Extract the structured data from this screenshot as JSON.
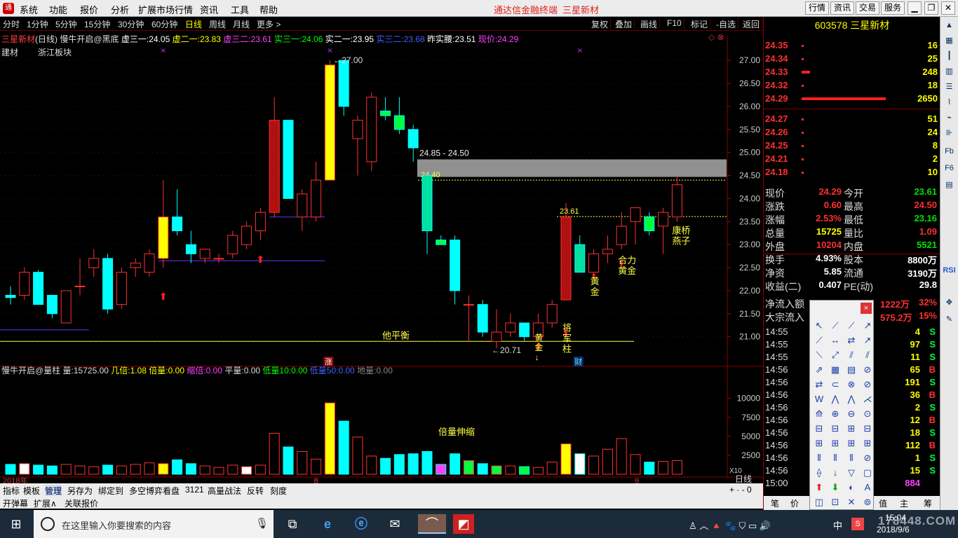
{
  "menu": {
    "items": [
      "系统",
      "功能",
      "报价",
      "分析",
      "扩展市场行情",
      "资讯",
      "工具",
      "帮助"
    ],
    "app_title": "通达信金融终端",
    "stock_title": "三星新材",
    "right_buttons": [
      "行情",
      "资讯",
      "交易",
      "服务"
    ]
  },
  "periods": {
    "items": [
      "分时",
      "1分钟",
      "5分钟",
      "15分钟",
      "30分钟",
      "60分钟",
      "日线",
      "周线",
      "月线",
      "更多 >"
    ],
    "active": "日线"
  },
  "toolbar": {
    "buttons": [
      "复权",
      "叠加",
      "画线",
      "F10",
      "标记",
      "-自选",
      "返回"
    ]
  },
  "info": {
    "stock": "三星新材",
    "period": "(日线)",
    "indicator": "慢牛开启@黑底",
    "items": [
      {
        "label": "虚三一:",
        "value": "24.05",
        "color": "#ffffff"
      },
      {
        "label": "虚二一:",
        "value": "23.83",
        "color": "#ffff00"
      },
      {
        "label": "虚三二:",
        "value": "23.61",
        "color": "#ff40ff"
      },
      {
        "label": "实三一:",
        "value": "24.06",
        "color": "#00ff00"
      },
      {
        "label": "实二一:",
        "value": "23.95",
        "color": "#ffffff"
      },
      {
        "label": "实三二:",
        "value": "23.68",
        "color": "#4060ff"
      },
      {
        "label": "昨实腰:",
        "value": "23.51",
        "color": "#ffffff"
      },
      {
        "label": "现价:",
        "value": "24.29",
        "color": "#ff40ff"
      }
    ],
    "sector1": "建材",
    "sector2": "浙江板块"
  },
  "chart_data": {
    "type": "candlestick",
    "y_range": [
      20.6,
      27.2
    ],
    "y_ticks": [
      "27.00",
      "26.50",
      "26.00",
      "25.50",
      "25.00",
      "24.50",
      "24.00",
      "23.50",
      "23.00",
      "22.50",
      "22.00",
      "21.50",
      "21.00"
    ],
    "candles": [
      {
        "o": 21.9,
        "h": 22.1,
        "l": 21.7,
        "c": 21.85
      },
      {
        "o": 21.9,
        "h": 22.5,
        "l": 21.8,
        "c": 22.4
      },
      {
        "o": 22.4,
        "h": 22.45,
        "l": 21.7,
        "c": 21.7
      },
      {
        "o": 21.9,
        "h": 21.9,
        "l": 21.4,
        "c": 21.5
      },
      {
        "o": 21.3,
        "h": 22.0,
        "l": 21.3,
        "c": 22.0
      },
      {
        "o": 22.1,
        "h": 22.7,
        "l": 21.9,
        "c": 22.1
      },
      {
        "o": 22.5,
        "h": 22.9,
        "l": 22.3,
        "c": 22.7
      },
      {
        "o": 22.7,
        "h": 22.8,
        "l": 21.5,
        "c": 21.6
      },
      {
        "o": 21.7,
        "h": 22.5,
        "l": 21.6,
        "c": 22.4
      },
      {
        "o": 22.5,
        "h": 22.7,
        "l": 22.3,
        "c": 22.6
      },
      {
        "o": 22.4,
        "h": 22.9,
        "l": 22.3,
        "c": 22.8
      },
      {
        "o": 22.7,
        "h": 24.4,
        "l": 22.5,
        "c": 23.6
      },
      {
        "o": 23.6,
        "h": 24.2,
        "l": 23.2,
        "c": 23.3
      },
      {
        "o": 23.0,
        "h": 23.3,
        "l": 22.6,
        "c": 22.8
      },
      {
        "o": 22.7,
        "h": 22.9,
        "l": 22.6,
        "c": 22.9
      },
      {
        "o": 22.7,
        "h": 22.8,
        "l": 22.6,
        "c": 22.7
      },
      {
        "o": 22.8,
        "h": 23.3,
        "l": 22.7,
        "c": 23.2
      },
      {
        "o": 23.0,
        "h": 23.5,
        "l": 22.9,
        "c": 23.4
      },
      {
        "o": 23.3,
        "h": 23.8,
        "l": 23.1,
        "c": 23.7
      },
      {
        "o": 23.7,
        "h": 26.2,
        "l": 23.6,
        "c": 25.7
      },
      {
        "o": 25.7,
        "h": 25.7,
        "l": 24.0,
        "c": 24.0
      },
      {
        "o": 23.6,
        "h": 24.2,
        "l": 23.3,
        "c": 24.1
      },
      {
        "o": 23.6,
        "h": 24.8,
        "l": 23.5,
        "c": 24.4
      },
      {
        "o": 24.4,
        "h": 27.0,
        "l": 24.4,
        "c": 26.9
      },
      {
        "o": 27.0,
        "h": 27.0,
        "l": 25.8,
        "c": 26.0
      },
      {
        "o": 25.3,
        "h": 25.8,
        "l": 24.5,
        "c": 25.7
      },
      {
        "o": 24.8,
        "h": 26.3,
        "l": 24.6,
        "c": 26.2
      },
      {
        "o": 25.9,
        "h": 26.2,
        "l": 25.7,
        "c": 25.8
      },
      {
        "o": 25.8,
        "h": 26.2,
        "l": 25.4,
        "c": 25.5
      },
      {
        "o": 25.5,
        "h": 25.6,
        "l": 24.8,
        "c": 25.1
      },
      {
        "o": 24.5,
        "h": 24.5,
        "l": 22.8,
        "c": 23.3
      },
      {
        "o": 23.1,
        "h": 23.2,
        "l": 23.0,
        "c": 23.0
      },
      {
        "o": 23.1,
        "h": 23.2,
        "l": 21.7,
        "c": 22.0
      },
      {
        "o": 21.7,
        "h": 21.9,
        "l": 20.9,
        "c": 21.7
      },
      {
        "o": 21.7,
        "h": 21.8,
        "l": 21.0,
        "c": 21.1
      },
      {
        "o": 20.9,
        "h": 21.6,
        "l": 20.75,
        "c": 21.1
      },
      {
        "o": 21.1,
        "h": 21.5,
        "l": 21.0,
        "c": 21.3
      },
      {
        "o": 21.3,
        "h": 21.3,
        "l": 20.9,
        "c": 21.0
      },
      {
        "o": 21.0,
        "h": 21.5,
        "l": 20.8,
        "c": 21.3
      },
      {
        "o": 21.3,
        "h": 21.8,
        "l": 21.2,
        "c": 21.7
      },
      {
        "o": 21.8,
        "h": 23.9,
        "l": 21.8,
        "c": 23.6
      },
      {
        "o": 23.0,
        "h": 23.2,
        "l": 22.4,
        "c": 22.4
      },
      {
        "o": 22.4,
        "h": 22.9,
        "l": 22.3,
        "c": 22.8
      },
      {
        "o": 22.8,
        "h": 23.2,
        "l": 22.6,
        "c": 22.9
      },
      {
        "o": 23.0,
        "h": 23.7,
        "l": 22.9,
        "c": 23.4
      },
      {
        "o": 23.5,
        "h": 23.8,
        "l": 23.0,
        "c": 23.8
      },
      {
        "o": 23.6,
        "h": 23.7,
        "l": 23.2,
        "c": 23.3
      },
      {
        "o": 23.4,
        "h": 23.8,
        "l": 22.8,
        "c": 23.7
      },
      {
        "o": 23.6,
        "h": 24.5,
        "l": 23.5,
        "c": 24.3
      }
    ],
    "volume_ticks": [
      "10000",
      "7500",
      "5000",
      "2500"
    ],
    "volume_max": 12000,
    "volumes": [
      1300,
      1400,
      1200,
      1100,
      1300,
      1100,
      1000,
      1200,
      1100,
      1300,
      1500,
      1400,
      1900,
      1400,
      1100,
      900,
      1200,
      1000,
      1200,
      5400,
      3600,
      3000,
      2000,
      9400,
      7000,
      4900,
      2400,
      2100,
      2600,
      2700,
      3000,
      1300,
      2700,
      1800,
      1400,
      1100,
      1100,
      1000,
      900,
      1600,
      4000,
      2700,
      2400,
      3300,
      4700,
      2600,
      1600,
      1700,
      1800
    ],
    "annotations": {
      "high_label": "←27.00",
      "low_label": "←20.71",
      "zone_label": "24.85 - 24.50",
      "line_2440": "24.40",
      "line_2361": "23.61",
      "balance": "他平衡",
      "jiangjun": "将\n军\n柱",
      "huangjin1": "黄\n金",
      "huangjin2": "黄\n金",
      "heli": "合力\n黄金",
      "kangqiao": "康桥\n燕子",
      "bell": "黄\n金\n↓",
      "zhang": "涨",
      "cai": "财",
      "volume_label": "倍量伸缩",
      "year_label": "2018年",
      "month8": "8",
      "month9": "9"
    }
  },
  "volinfo": {
    "indicator": "慢牛开启@量柱",
    "items": [
      {
        "label": "量:",
        "value": "15725.00",
        "color": "#dddddd"
      },
      {
        "label": "几倍:",
        "value": "1.08",
        "color": "#ffff00"
      },
      {
        "label": "倍量:",
        "value": "0.00",
        "color": "#ffff00"
      },
      {
        "label": "缩倍:",
        "value": "0.00",
        "color": "#ff40ff"
      },
      {
        "label": "平量:",
        "value": "0.00",
        "color": "#dddddd"
      },
      {
        "label": "低量10:",
        "value": "0.00",
        "color": "#00ff00"
      },
      {
        "label": "低量50:",
        "value": "0.00",
        "color": "#4060ff"
      },
      {
        "label": "地量:",
        "value": "0.00",
        "color": "#888888"
      }
    ],
    "x10": "X10"
  },
  "bottom": {
    "tabs1": [
      "指标",
      "模板",
      "管理",
      "另存为",
      "绑定到",
      "多空博弈看盘",
      "3121",
      "高量战法",
      "反转",
      "刻度"
    ],
    "tabs2": [
      "开弹幕",
      "扩展∧",
      "关联报价"
    ],
    "period": "日线"
  },
  "right": {
    "code": "603578",
    "name": "三星新材",
    "asks": [
      {
        "price": "24.35",
        "vol": "16",
        "bar": 0
      },
      {
        "price": "24.34",
        "vol": "25",
        "bar": 0
      },
      {
        "price": "24.33",
        "vol": "248",
        "bar": 12
      },
      {
        "price": "24.32",
        "vol": "18",
        "bar": 0
      },
      {
        "price": "24.29",
        "vol": "2650",
        "bar": 120
      }
    ],
    "bids": [
      {
        "price": "24.27",
        "vol": "51"
      },
      {
        "price": "24.26",
        "vol": "24"
      },
      {
        "price": "24.25",
        "vol": "8"
      },
      {
        "price": "24.21",
        "vol": "2"
      },
      {
        "price": "24.18",
        "vol": "10"
      }
    ],
    "quote": [
      {
        "l1": "现价",
        "v1": "24.29",
        "l2": "今开",
        "v2": "23.61",
        "c1": "#ff3030",
        "c2": "#00e000"
      },
      {
        "l1": "涨跌",
        "v1": "0.60",
        "l2": "最高",
        "v2": "24.50",
        "c1": "#ff3030",
        "c2": "#ff3030"
      },
      {
        "l1": "涨幅",
        "v1": "2.53%",
        "l2": "最低",
        "v2": "23.16",
        "c1": "#ff3030",
        "c2": "#00e000"
      },
      {
        "l1": "总量",
        "v1": "15725",
        "l2": "量比",
        "v2": "1.09",
        "c1": "#ffff00",
        "c2": "#ff3030"
      },
      {
        "l1": "外盘",
        "v1": "10204",
        "l2": "内盘",
        "v2": "5521",
        "c1": "#ff3030",
        "c2": "#00e000"
      },
      {
        "l1": "换手",
        "v1": "4.93%",
        "l2": "股本",
        "v2": "8800万",
        "c1": "#ffffff",
        "c2": "#ffffff"
      },
      {
        "l1": "净资",
        "v1": "5.85",
        "l2": "流通",
        "v2": "3190万",
        "c1": "#ffffff",
        "c2": "#ffffff"
      },
      {
        "l1": "收益(二)",
        "v1": "0.407",
        "l2": "PE(动)",
        "v2": "29.8",
        "c1": "#ffffff",
        "c2": "#ffffff"
      }
    ],
    "flow": [
      {
        "label": "净流入额",
        "v1": "1222万",
        "v2": "32%"
      },
      {
        "label": "大宗流入",
        "v1": "575.2万",
        "v2": "15%"
      }
    ],
    "trades": [
      {
        "t": "14:55",
        "v": "4",
        "s": "S"
      },
      {
        "t": "14:55",
        "v": "97",
        "s": "S"
      },
      {
        "t": "14:55",
        "v": "11",
        "s": "S"
      },
      {
        "t": "14:56",
        "v": "65",
        "s": "B"
      },
      {
        "t": "14:56",
        "v": "191",
        "s": "S"
      },
      {
        "t": "14:56",
        "v": "36",
        "s": "B"
      },
      {
        "t": "14:56",
        "v": "2",
        "s": "S"
      },
      {
        "t": "14:56",
        "v": "12",
        "s": "B"
      },
      {
        "t": "14:56",
        "v": "18",
        "s": "S"
      },
      {
        "t": "14:56",
        "v": "112",
        "s": "B"
      },
      {
        "t": "14:56",
        "v": "1",
        "s": "S"
      },
      {
        "t": "14:56",
        "v": "15",
        "s": "S"
      },
      {
        "t": "15:00",
        "v": "884",
        "s": ""
      }
    ],
    "bottom_tabs": [
      "笔",
      "价",
      "值",
      "主",
      "筹"
    ]
  },
  "taskbar": {
    "search_placeholder": "在这里输入你要搜索的内容",
    "ime": "中",
    "time": "15:04",
    "date": "2018/9/6",
    "watermark": "178448.COM"
  }
}
